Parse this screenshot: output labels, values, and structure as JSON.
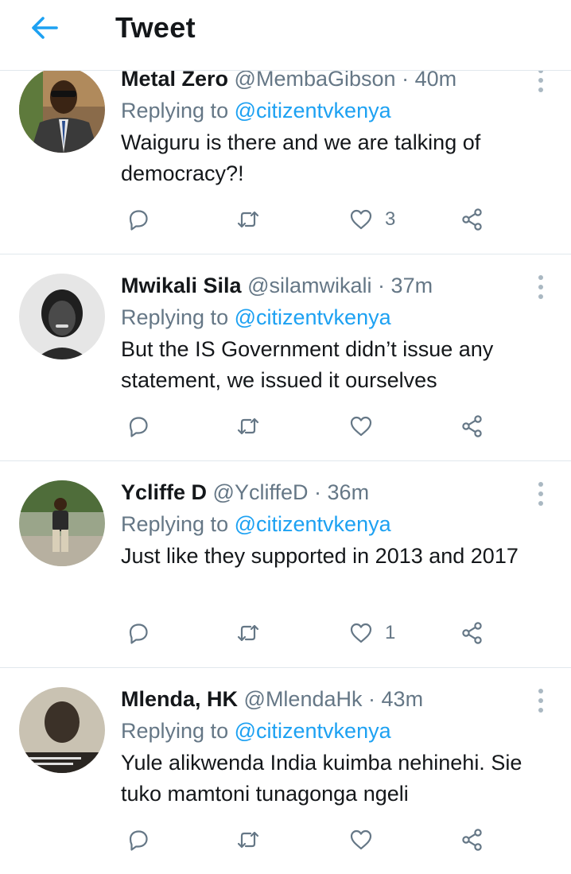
{
  "header": {
    "title": "Tweet",
    "back_icon": "arrow-left-icon",
    "accent": "#1da1f2"
  },
  "tweets": [
    {
      "display_name": "Metal Zero",
      "handle": "@MembaGibson",
      "separator": "·",
      "time": "40m",
      "replying_prefix": "Replying to",
      "replying_to": "@citizentvkenya",
      "text": "Waiguru is there and we are talking of democracy?!",
      "likes": "3"
    },
    {
      "display_name": "Mwikali Sila",
      "handle": "@silamwikali",
      "separator": "·",
      "time": "37m",
      "replying_prefix": "Replying to",
      "replying_to": "@citizentvkenya",
      "text": "But the IS Government didn’t issue any statement, we issued it ourselves",
      "likes": ""
    },
    {
      "display_name": "Ycliffe D",
      "handle": "@YcliffeD",
      "separator": "·",
      "time": "36m",
      "replying_prefix": "Replying to",
      "replying_to": "@citizentvkenya",
      "text": "Just like they supported in 2013 and 2017",
      "likes": "1"
    },
    {
      "display_name": "Mlenda, HK",
      "handle": "@MlendaHk",
      "separator": "·",
      "time": "43m",
      "replying_prefix": "Replying to",
      "replying_to": "@citizentvkenya",
      "text": "Yule alikwenda India kuimba nehinehi. Sie tuko mamtoni tunagonga ngeli",
      "likes": ""
    }
  ],
  "icons": [
    "reply-icon",
    "retweet-icon",
    "heart-icon",
    "share-icon",
    "more-vertical-icon"
  ]
}
